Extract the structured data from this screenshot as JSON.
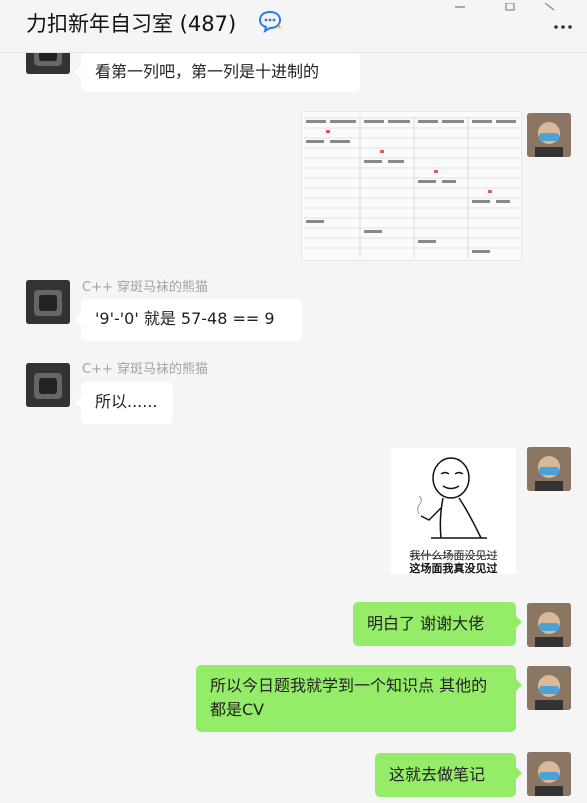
{
  "header": {
    "title": "力扣新年自习室 (487)"
  },
  "messages": {
    "m1": {
      "text": "看第一列吧，第一列是十进制的"
    },
    "m3": {
      "sender": "C++ 穿斑马袜的熊猫",
      "text": "'9'-'0' 就是 57-48 == 9"
    },
    "m4": {
      "sender": "C++ 穿斑马袜的熊猫",
      "text": "所以......"
    },
    "m5": {
      "caption_strike": "我什么场面没见过",
      "caption": "这场面我真没见过"
    },
    "m6": {
      "text": "明白了  谢谢大佬"
    },
    "m7": {
      "text": "所以今日题我就学到一个知识点 其他的都是CV"
    },
    "m8": {
      "text": "这就去做笔记"
    }
  },
  "colors": {
    "background": "#f5f5f5",
    "bubble_self": "#95ec69",
    "bubble_other": "#ffffff",
    "sender_name": "#a3a3a3"
  },
  "icons": [
    "chat-bubble-icon",
    "more-icon"
  ]
}
